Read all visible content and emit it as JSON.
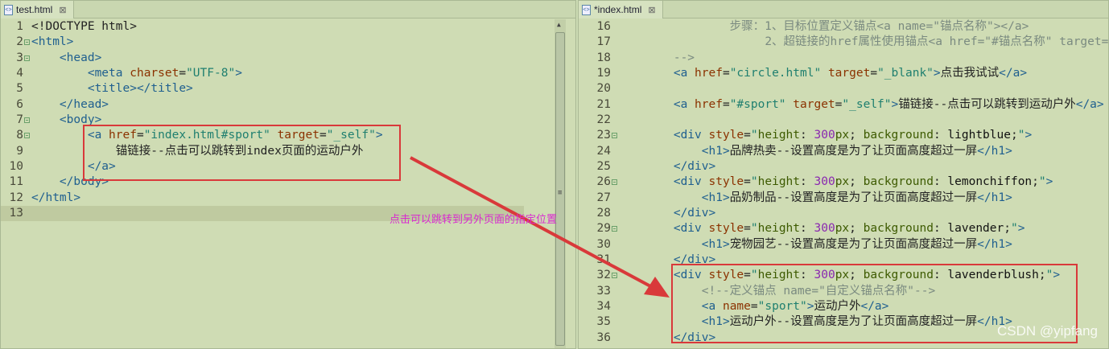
{
  "left": {
    "tab": "test.html",
    "close": "⊠",
    "lines": [
      {
        "n": "1",
        "f": false,
        "k": [
          [
            "x",
            "<!DOCTYPE html>"
          ]
        ]
      },
      {
        "n": "2",
        "f": true,
        "k": [
          [
            "t",
            "<html>"
          ]
        ]
      },
      {
        "n": "3",
        "f": true,
        "k": [
          [
            "x",
            "    "
          ],
          [
            "t",
            "<head>"
          ]
        ]
      },
      {
        "n": "4",
        "f": false,
        "k": [
          [
            "x",
            "        "
          ],
          [
            "t",
            "<meta "
          ],
          [
            "a",
            "charset"
          ],
          [
            "x",
            "="
          ],
          [
            "s",
            "\"UTF-8\""
          ],
          [
            "t",
            ">"
          ]
        ]
      },
      {
        "n": "5",
        "f": false,
        "k": [
          [
            "x",
            "        "
          ],
          [
            "t",
            "<title></title>"
          ]
        ]
      },
      {
        "n": "6",
        "f": false,
        "k": [
          [
            "x",
            "    "
          ],
          [
            "t",
            "</head>"
          ]
        ]
      },
      {
        "n": "7",
        "f": true,
        "k": [
          [
            "x",
            "    "
          ],
          [
            "t",
            "<body>"
          ]
        ]
      },
      {
        "n": "8",
        "f": true,
        "k": [
          [
            "x",
            "        "
          ],
          [
            "t",
            "<a "
          ],
          [
            "a",
            "href"
          ],
          [
            "x",
            "="
          ],
          [
            "s",
            "\"index.html#sport\""
          ],
          [
            "x",
            " "
          ],
          [
            "a",
            "target"
          ],
          [
            "x",
            "="
          ],
          [
            "s",
            "\"_self\""
          ],
          [
            "t",
            ">"
          ]
        ]
      },
      {
        "n": "9",
        "f": false,
        "k": [
          [
            "x",
            "            锚链接--点击可以跳转到index页面的运动户外"
          ]
        ]
      },
      {
        "n": "10",
        "f": false,
        "k": [
          [
            "x",
            "        "
          ],
          [
            "t",
            "</a>"
          ]
        ]
      },
      {
        "n": "11",
        "f": false,
        "k": [
          [
            "x",
            "    "
          ],
          [
            "t",
            "</body>"
          ]
        ]
      },
      {
        "n": "12",
        "f": false,
        "k": [
          [
            "t",
            "</html>"
          ]
        ]
      },
      {
        "n": "13",
        "f": false,
        "cur": true,
        "k": []
      }
    ]
  },
  "right": {
    "tab": "*index.html",
    "close": "⊠",
    "lines": [
      {
        "n": "16",
        "f": false,
        "k": [
          [
            "c",
            "                步骤：1、目标位置定义锚点<a name=\"锚点名称\"></a>"
          ]
        ]
      },
      {
        "n": "17",
        "f": false,
        "k": [
          [
            "c",
            "                     2、超链接的href属性使用锚点<a href=\"#锚点名称\" target="
          ]
        ]
      },
      {
        "n": "18",
        "f": false,
        "k": [
          [
            "c",
            "        -->"
          ]
        ]
      },
      {
        "n": "19",
        "f": false,
        "k": [
          [
            "x",
            "        "
          ],
          [
            "t",
            "<a "
          ],
          [
            "a",
            "href"
          ],
          [
            "x",
            "="
          ],
          [
            "s",
            "\"circle.html\""
          ],
          [
            "x",
            " "
          ],
          [
            "a",
            "target"
          ],
          [
            "x",
            "="
          ],
          [
            "s",
            "\"_blank\""
          ],
          [
            "t",
            ">"
          ],
          [
            "x",
            "点击我试试"
          ],
          [
            "t",
            "</a>"
          ]
        ]
      },
      {
        "n": "20",
        "f": false,
        "k": []
      },
      {
        "n": "21",
        "f": false,
        "k": [
          [
            "x",
            "        "
          ],
          [
            "t",
            "<a "
          ],
          [
            "a",
            "href"
          ],
          [
            "x",
            "="
          ],
          [
            "s",
            "\"#sport\""
          ],
          [
            "x",
            " "
          ],
          [
            "a",
            "target"
          ],
          [
            "x",
            "="
          ],
          [
            "s",
            "\"_self\""
          ],
          [
            "t",
            ">"
          ],
          [
            "x",
            "锚链接--点击可以跳转到运动户外"
          ],
          [
            "t",
            "</a>"
          ]
        ]
      },
      {
        "n": "22",
        "f": false,
        "k": []
      },
      {
        "n": "23",
        "f": true,
        "k": [
          [
            "x",
            "        "
          ],
          [
            "t",
            "<div "
          ],
          [
            "a",
            "style"
          ],
          [
            "x",
            "="
          ],
          [
            "s",
            "\""
          ],
          [
            "p",
            "height"
          ],
          [
            "x",
            ": "
          ],
          [
            "n",
            "300"
          ],
          [
            "p",
            "px"
          ],
          [
            "x",
            "; "
          ],
          [
            "p",
            "background"
          ],
          [
            "x",
            ": "
          ],
          [
            "v",
            "lightblue"
          ],
          [
            "x",
            ";"
          ],
          [
            "s",
            "\""
          ],
          [
            "t",
            ">"
          ]
        ]
      },
      {
        "n": "24",
        "f": false,
        "k": [
          [
            "x",
            "            "
          ],
          [
            "t",
            "<h1>"
          ],
          [
            "x",
            "品牌热卖--设置高度是为了让页面高度超过一屏"
          ],
          [
            "t",
            "</h1>"
          ]
        ]
      },
      {
        "n": "25",
        "f": false,
        "k": [
          [
            "x",
            "        "
          ],
          [
            "t",
            "</div>"
          ]
        ]
      },
      {
        "n": "26",
        "f": true,
        "k": [
          [
            "x",
            "        "
          ],
          [
            "t",
            "<div "
          ],
          [
            "a",
            "style"
          ],
          [
            "x",
            "="
          ],
          [
            "s",
            "\""
          ],
          [
            "p",
            "height"
          ],
          [
            "x",
            ": "
          ],
          [
            "n",
            "300"
          ],
          [
            "p",
            "px"
          ],
          [
            "x",
            "; "
          ],
          [
            "p",
            "background"
          ],
          [
            "x",
            ": "
          ],
          [
            "v",
            "lemonchiffon"
          ],
          [
            "x",
            ";"
          ],
          [
            "s",
            "\""
          ],
          [
            "t",
            ">"
          ]
        ]
      },
      {
        "n": "27",
        "f": false,
        "k": [
          [
            "x",
            "            "
          ],
          [
            "t",
            "<h1>"
          ],
          [
            "x",
            "品奶制品--设置高度是为了让页面高度超过一屏"
          ],
          [
            "t",
            "</h1>"
          ]
        ]
      },
      {
        "n": "28",
        "f": false,
        "k": [
          [
            "x",
            "        "
          ],
          [
            "t",
            "</div>"
          ]
        ]
      },
      {
        "n": "29",
        "f": true,
        "k": [
          [
            "x",
            "        "
          ],
          [
            "t",
            "<div "
          ],
          [
            "a",
            "style"
          ],
          [
            "x",
            "="
          ],
          [
            "s",
            "\""
          ],
          [
            "p",
            "height"
          ],
          [
            "x",
            ": "
          ],
          [
            "n",
            "300"
          ],
          [
            "p",
            "px"
          ],
          [
            "x",
            "; "
          ],
          [
            "p",
            "background"
          ],
          [
            "x",
            ": "
          ],
          [
            "v",
            "lavender"
          ],
          [
            "x",
            ";"
          ],
          [
            "s",
            "\""
          ],
          [
            "t",
            ">"
          ]
        ]
      },
      {
        "n": "30",
        "f": false,
        "k": [
          [
            "x",
            "            "
          ],
          [
            "t",
            "<h1>"
          ],
          [
            "x",
            "宠物园艺--设置高度是为了让页面高度超过一屏"
          ],
          [
            "t",
            "</h1>"
          ]
        ]
      },
      {
        "n": "31",
        "f": false,
        "k": [
          [
            "x",
            "        "
          ],
          [
            "t",
            "</div>"
          ]
        ]
      },
      {
        "n": "32",
        "f": true,
        "k": [
          [
            "x",
            "        "
          ],
          [
            "t",
            "<div "
          ],
          [
            "a",
            "style"
          ],
          [
            "x",
            "="
          ],
          [
            "s",
            "\""
          ],
          [
            "p",
            "height"
          ],
          [
            "x",
            ": "
          ],
          [
            "n",
            "300"
          ],
          [
            "p",
            "px"
          ],
          [
            "x",
            "; "
          ],
          [
            "p",
            "background"
          ],
          [
            "x",
            ": "
          ],
          [
            "v",
            "lavenderblush"
          ],
          [
            "x",
            ";"
          ],
          [
            "s",
            "\""
          ],
          [
            "t",
            ">"
          ]
        ]
      },
      {
        "n": "33",
        "f": false,
        "k": [
          [
            "x",
            "            "
          ],
          [
            "c",
            "<!--定义锚点 name=\"自定义锚点名称\"-->"
          ]
        ]
      },
      {
        "n": "34",
        "f": false,
        "k": [
          [
            "x",
            "            "
          ],
          [
            "t",
            "<a "
          ],
          [
            "a",
            "name"
          ],
          [
            "x",
            "="
          ],
          [
            "s",
            "\"sport\""
          ],
          [
            "t",
            ">"
          ],
          [
            "x",
            "运动户外"
          ],
          [
            "t",
            "</a>"
          ]
        ]
      },
      {
        "n": "35",
        "f": false,
        "k": [
          [
            "x",
            "            "
          ],
          [
            "t",
            "<h1>"
          ],
          [
            "x",
            "运动户外--设置高度是为了让页面高度超过一屏"
          ],
          [
            "t",
            "</h1>"
          ]
        ]
      },
      {
        "n": "36",
        "f": false,
        "k": [
          [
            "x",
            "        "
          ],
          [
            "t",
            "</div>"
          ]
        ]
      }
    ]
  },
  "annotation": "点击可以跳转到另外页面的指定位置",
  "watermark": "CSDN @yipfang",
  "colors": {
    "background": "#cfdcb4",
    "highlight_box": "#d9393a",
    "annotation": "#d92ad0"
  }
}
